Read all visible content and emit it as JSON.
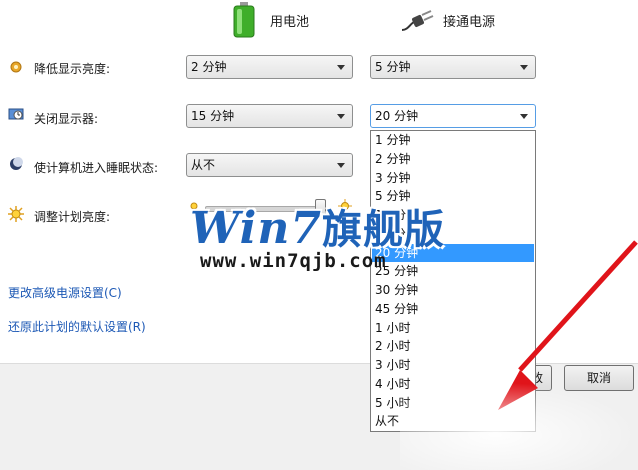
{
  "columns": {
    "battery_label": "用电池",
    "plugged_label": "接通电源"
  },
  "rows": [
    {
      "label": "降低显示亮度:",
      "battery": "2 分钟",
      "plugged": "5 分钟"
    },
    {
      "label": "关闭显示器:",
      "battery": "15 分钟",
      "plugged": "20 分钟"
    },
    {
      "label": "使计算机进入睡眠状态:",
      "battery": "从不"
    },
    {
      "label": "调整计划亮度:"
    }
  ],
  "brightness": {
    "battery_level": 0.97,
    "plugged_level": 0.5
  },
  "dropdown": {
    "options": [
      "1 分钟",
      "2 分钟",
      "3 分钟",
      "5 分钟",
      "10 分钟",
      "15 分钟",
      "20 分钟",
      "25 分钟",
      "30 分钟",
      "45 分钟",
      "1 小时",
      "2 小时",
      "3 小时",
      "4 小时",
      "5 小时",
      "从不"
    ],
    "selected": "20 分钟"
  },
  "links": {
    "advanced": "更改高级电源设置(C)",
    "restore": "还原此计划的默认设置(R)"
  },
  "buttons": {
    "save_partial": "改",
    "cancel": "取消"
  },
  "watermark": {
    "title_latin": "Win7",
    "title_cn": "旗舰版",
    "url": "www.win7qjb.com"
  },
  "colors": {
    "link": "#1c58b5",
    "selection": "#3399ff",
    "arrow": "#e0141a",
    "watermark": "#1f63b8"
  }
}
